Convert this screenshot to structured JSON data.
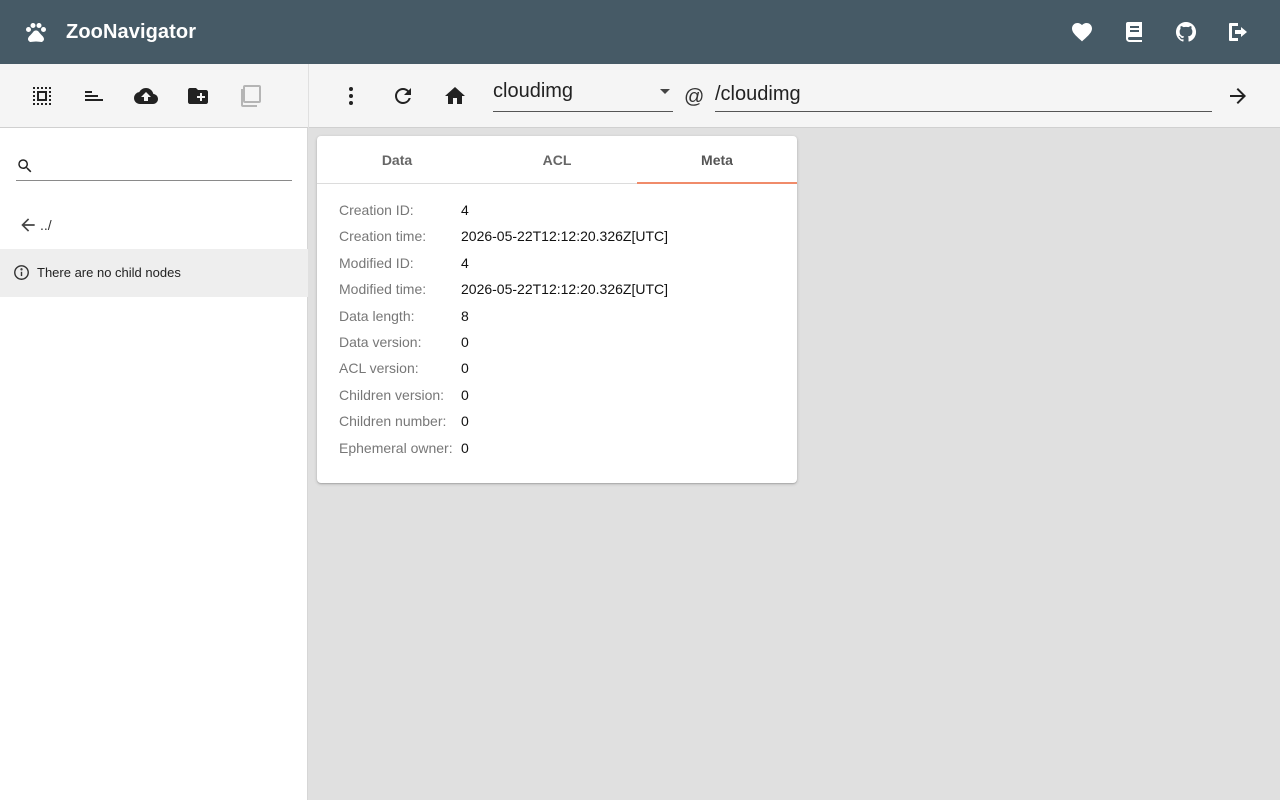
{
  "app": {
    "title": "ZooNavigator",
    "icons": {
      "brand": "paw-icon",
      "donate": "heart-icon",
      "docs": "book-icon",
      "github": "github-icon",
      "logout": "logout-icon"
    }
  },
  "sidebar": {
    "toolbar_icons": [
      "select-all-icon",
      "sort-icon",
      "upload-icon",
      "create-folder-icon",
      "copy-icon"
    ],
    "search": {
      "value": "",
      "placeholder": ""
    },
    "up_label": "../",
    "empty_message": "There are no child nodes"
  },
  "toolbar": {
    "connection": "cloudimg",
    "at": "@",
    "path": "/cloudimg",
    "icons": [
      "more-vert-icon",
      "refresh-icon",
      "home-icon",
      "arrow-forward-icon"
    ]
  },
  "tabs": [
    "Data",
    "ACL",
    "Meta"
  ],
  "active_tab": "Meta",
  "meta": [
    {
      "key": "Creation ID:",
      "value": "4"
    },
    {
      "key": "Creation time:",
      "value": "2026-05-22T12:12:20.326Z[UTC]"
    },
    {
      "key": "Modified ID:",
      "value": "4"
    },
    {
      "key": "Modified time:",
      "value": "2026-05-22T12:12:20.326Z[UTC]"
    },
    {
      "key": "Data length:",
      "value": "8"
    },
    {
      "key": "Data version:",
      "value": "0"
    },
    {
      "key": "ACL version:",
      "value": "0"
    },
    {
      "key": "Children version:",
      "value": "0"
    },
    {
      "key": "Children number:",
      "value": "0"
    },
    {
      "key": "Ephemeral owner:",
      "value": "0"
    }
  ],
  "colors": {
    "appbar": "#465a66",
    "tab_indicator": "#f08b6a",
    "panel_background": "#e0e0e0"
  }
}
